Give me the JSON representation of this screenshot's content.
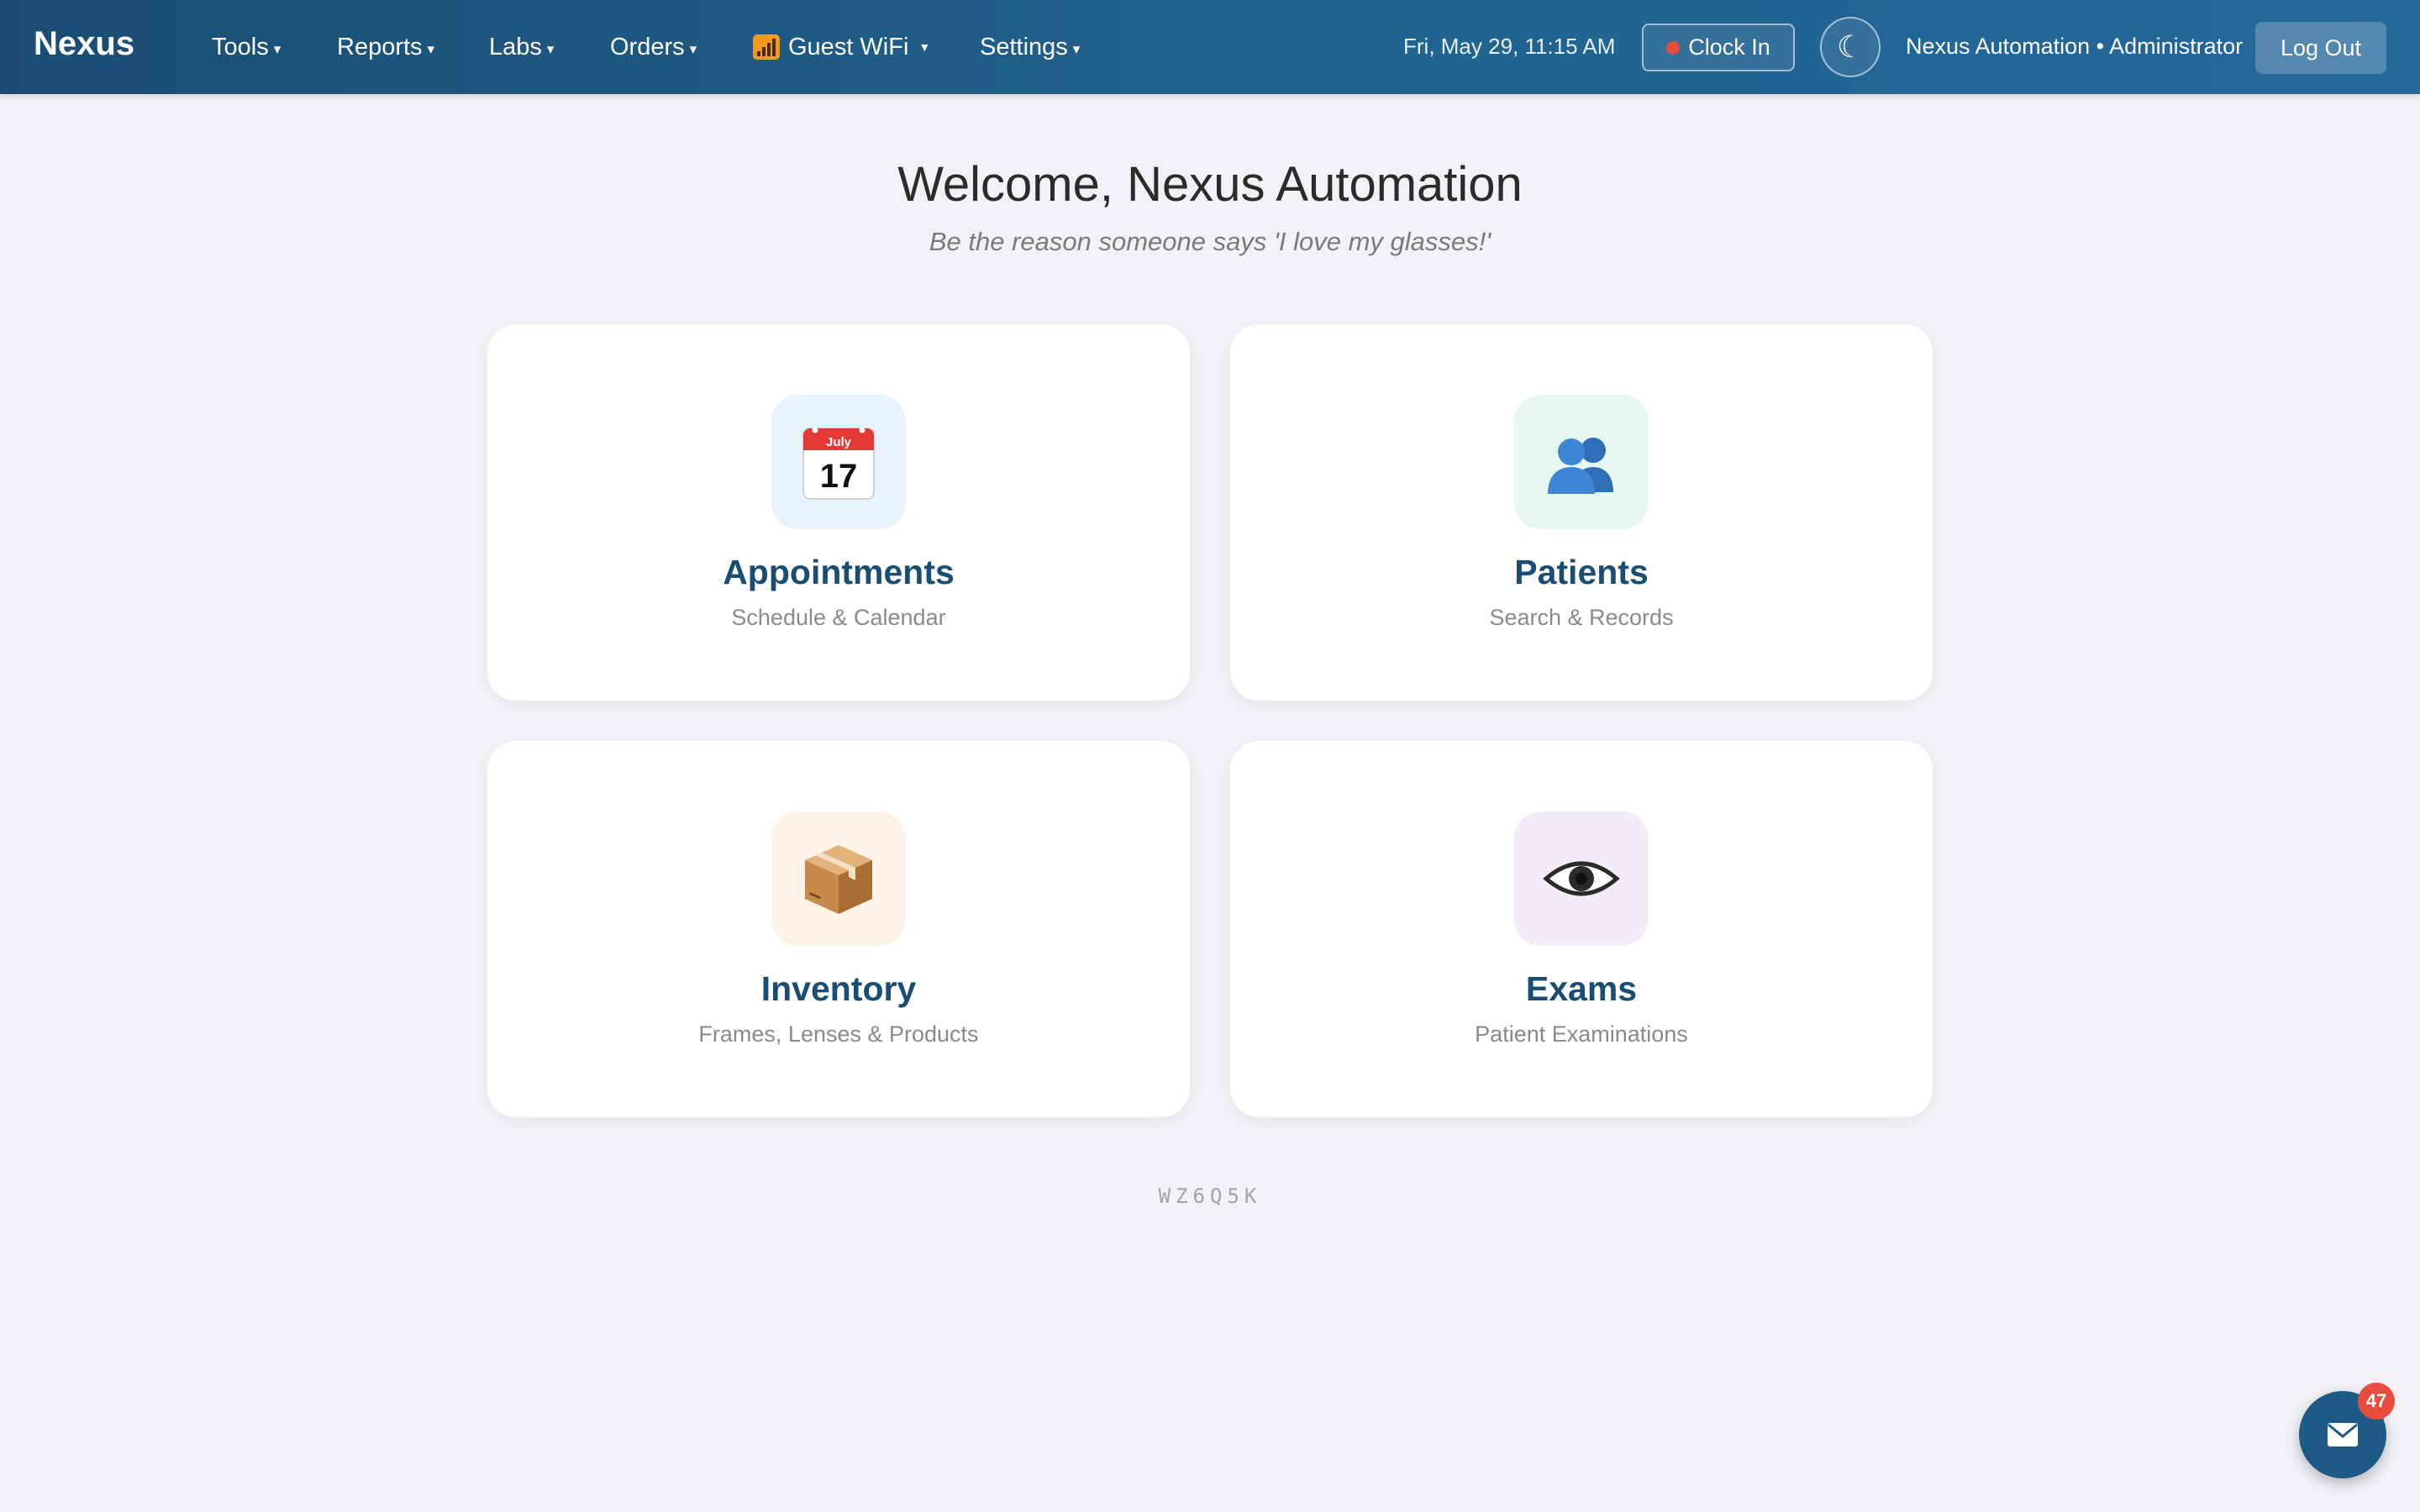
{
  "navbar": {
    "brand": "Nexus",
    "menu": [
      {
        "label": "Tools",
        "caret": "▾"
      },
      {
        "label": "Reports",
        "caret": "▾"
      },
      {
        "label": "Labs",
        "caret": "▾"
      },
      {
        "label": "Orders",
        "caret": "▾"
      },
      {
        "label": "Guest WiFi",
        "caret": "▼",
        "icon": "wifi-signal-icon"
      },
      {
        "label": "Settings",
        "caret": "▾"
      }
    ],
    "datetime": "Fri, May 29, 11:15 AM",
    "clock_in_label": "Clock In",
    "theme_toggle_glyph": "☾",
    "user_label": "Nexus Automation • Administrator",
    "logout_label": "Log Out"
  },
  "welcome": {
    "title": "Welcome, Nexus Automation",
    "tagline": "Be the reason someone says 'I love my glasses!'"
  },
  "cards": [
    {
      "title": "Appointments",
      "subtitle": "Schedule & Calendar",
      "icon": "calendar-icon",
      "icon_bg": "#e8f2fc",
      "calendar_month": "July",
      "calendar_day": "17"
    },
    {
      "title": "Patients",
      "subtitle": "Search & Records",
      "icon": "people-icon",
      "icon_bg": "#e6f7f0"
    },
    {
      "title": "Inventory",
      "subtitle": "Frames, Lenses & Products",
      "icon": "package-icon",
      "icon_bg": "#fdf3e6"
    },
    {
      "title": "Exams",
      "subtitle": "Patient Examinations",
      "icon": "eye-icon",
      "icon_bg": "#f3ebf7"
    }
  ],
  "code": "WZ6Q5K",
  "messages": {
    "badge_count": "47",
    "icon": "envelope-icon"
  },
  "colors": {
    "navbar_start": "#1a4d73",
    "navbar_end": "#24689a",
    "card_title": "#1a4d73",
    "badge": "#e74c3c",
    "page_bg": "#f0f2f5"
  }
}
